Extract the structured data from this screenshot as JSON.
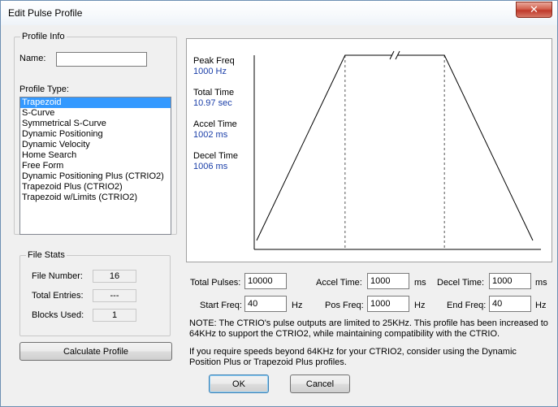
{
  "window": {
    "title": "Edit Pulse Profile",
    "close_glyph": "✕"
  },
  "profile_info": {
    "legend": "Profile Info",
    "name_label": "Name:",
    "name_value": "",
    "type_label": "Profile Type:",
    "types": [
      "Trapezoid",
      "S-Curve",
      "Symmetrical S-Curve",
      "Dynamic Positioning",
      "Dynamic Velocity",
      "Home Search",
      "Free Form",
      "Dynamic Positioning Plus (CTRIO2)",
      "Trapezoid Plus (CTRIO2)",
      "Trapezoid w/Limits (CTRIO2)"
    ],
    "selected_type": "Trapezoid"
  },
  "file_stats": {
    "legend": "File Stats",
    "file_number_label": "File Number:",
    "file_number": "16",
    "total_entries_label": "Total Entries:",
    "total_entries": "---",
    "blocks_used_label": "Blocks Used:",
    "blocks_used": "1"
  },
  "calculate_button": "Calculate Profile",
  "chart_info": {
    "peak_freq_label": "Peak Freq",
    "peak_freq": "1000 Hz",
    "total_time_label": "Total Time",
    "total_time": "10.97 sec",
    "accel_time_label": "Accel Time",
    "accel_time": "1002 ms",
    "decel_time_label": "Decel Time",
    "decel_time": "1006 ms"
  },
  "chart_data": {
    "type": "line",
    "title": "",
    "xlabel": "",
    "ylabel": "",
    "x": [
      0,
      1.002,
      9.964,
      10.97
    ],
    "y": [
      0,
      1000,
      1000,
      0
    ],
    "grid": false,
    "axis_break": true
  },
  "params": {
    "total_pulses_label": "Total Pulses:",
    "total_pulses": "10000",
    "accel_time_label": "Accel Time:",
    "accel_time": "1000",
    "accel_unit": "ms",
    "decel_time_label": "Decel Time:",
    "decel_time": "1000",
    "decel_unit": "ms",
    "start_freq_label": "Start Freq:",
    "start_freq": "40",
    "start_unit": "Hz",
    "pos_freq_label": "Pos Freq:",
    "pos_freq": "1000",
    "pos_unit": "Hz",
    "end_freq_label": "End Freq:",
    "end_freq": "40",
    "end_unit": "Hz"
  },
  "notes": {
    "note1": "NOTE: The CTRIO's pulse outputs are limited to 25KHz. This profile has been increased to 64KHz to support the CTRIO2, while maintaining compatibility with the CTRIO.",
    "note2": "If you require speeds beyond 64KHz for your CTRIO2, consider using the Dynamic Position Plus or Trapezoid Plus profiles."
  },
  "buttons": {
    "ok": "OK",
    "cancel": "Cancel"
  },
  "colors": {
    "selection": "#3399ff",
    "info_value": "#1a3ea8",
    "close": "#c0392b"
  }
}
